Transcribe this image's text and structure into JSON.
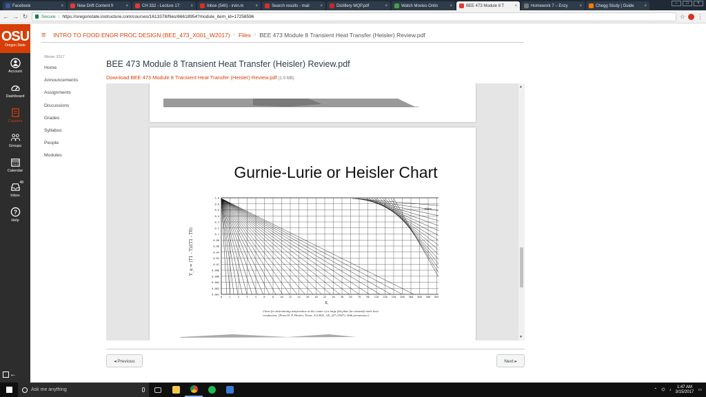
{
  "browser": {
    "tabs": [
      {
        "title": "Facebook",
        "color": "#3b5998"
      },
      {
        "title": "New Drift Content fr",
        "color": "#e53935"
      },
      {
        "title": "CH 332 - Lecture 17:",
        "color": "#e53935"
      },
      {
        "title": "Inbox (540) - irvin.m",
        "color": "#d93025"
      },
      {
        "title": "Search results - mail",
        "color": "#d93025"
      },
      {
        "title": "Distillery MQP.pdf",
        "color": "#c62828"
      },
      {
        "title": "Watch Movies Onlin",
        "color": "#43a047"
      },
      {
        "title": "BEE 473 Module 8 T",
        "color": "#e53935"
      },
      {
        "title": "Homework 7 – Enzy",
        "color": "#777777"
      },
      {
        "title": "Chegg Study | Guide",
        "color": "#f57c00"
      }
    ],
    "active_tab": 7,
    "secure_label": "Secure",
    "url": "https://oregonstate.instructure.com/courses/1613378/files/66618954?module_item_id=17258596"
  },
  "global_nav": {
    "logo": "OSU",
    "logo_sub": "Oregon State",
    "items": [
      {
        "label": "Account",
        "icon": "account-icon"
      },
      {
        "label": "Dashboard",
        "icon": "dashboard-icon"
      },
      {
        "label": "Courses",
        "icon": "courses-icon"
      },
      {
        "label": "Groups",
        "icon": "groups-icon"
      },
      {
        "label": "Calendar",
        "icon": "calendar-icon"
      },
      {
        "label": "Inbox",
        "icon": "inbox-icon",
        "badge": "48"
      },
      {
        "label": "Help",
        "icon": "help-icon"
      }
    ]
  },
  "breadcrumb": {
    "course": "INTRO TO FOOD ENGR PROC DESIGN (BEE_473_X001_W2017)",
    "files": "Files",
    "current": "BEE 473 Module 8 Transient Heat Transfer (Heisler) Review.pdf"
  },
  "course_nav": {
    "term": "Winter 2017",
    "items": [
      "Home",
      "Announcements",
      "Assignments",
      "Discussions",
      "Grades",
      "Syllabus",
      "People",
      "Modules"
    ]
  },
  "content": {
    "title": "BEE 473 Module 8 Transient Heat Transfer (Heisler) Review.pdf",
    "download": "Download BEE 473 Module 8 Transient Heat Transfer (Heisler) Review.pdf",
    "size": "(1.9 MB)"
  },
  "slide": {
    "title": "Gurnie-Lurie or Heisler Chart",
    "plate_label": "plate",
    "x_axis_label": "X,",
    "caption": "Chart for determining temperature at the center of a large flat plate for unsteady-state heat conduction. [From H. P. Heisler, Trans. A.S.M.E., 69, 227 (1947). With permission.]"
  },
  "chart_data": {
    "type": "line",
    "title": "Gurnie-Lurie or Heisler Chart",
    "ylabel": "Y_a = (T1 - T)/(T1 - T0)",
    "y_scale": "log",
    "y_ticks": [
      "1.0",
      "0.8",
      "0.6",
      "0.4",
      "0.3",
      "0.2",
      "0.1",
      "0.08",
      "0.06",
      "0.04",
      "0.02",
      "0.01",
      "0.008",
      "0.006",
      "0.004",
      "0.002",
      "0.001"
    ],
    "x_ticks": [
      "0",
      "1",
      "2",
      "3",
      "4",
      "6",
      "8",
      "10",
      "12",
      "14",
      "16",
      "18",
      "22",
      "26",
      "30",
      "50",
      "70",
      "90",
      "110",
      "130",
      "150",
      "200",
      "300",
      "400",
      "500",
      "600",
      "700"
    ]
  },
  "footer": {
    "prev": "◂ Previous",
    "next": "Next ▸"
  },
  "taskbar": {
    "search_placeholder": "Ask me anything",
    "time": "1:47 AM",
    "date": "3/15/2017"
  }
}
